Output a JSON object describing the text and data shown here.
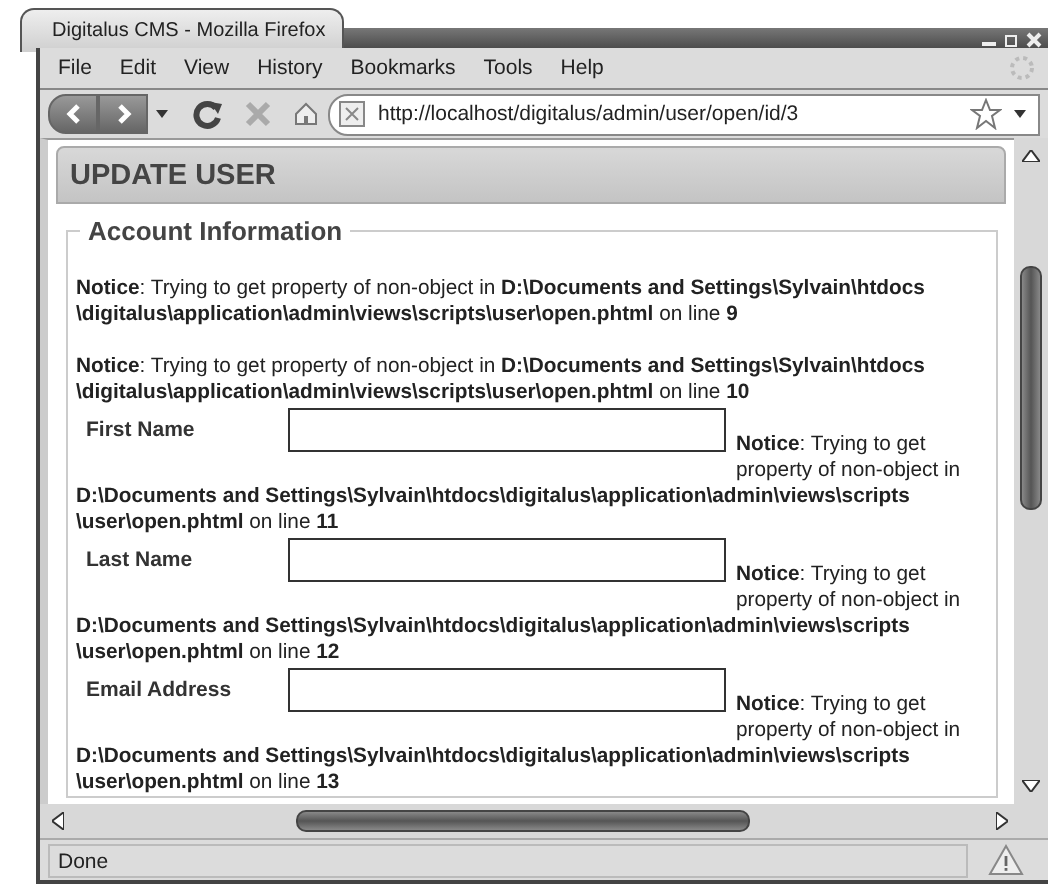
{
  "window": {
    "title": "Digitalus CMS - Mozilla Firefox"
  },
  "menu": [
    "File",
    "Edit",
    "View",
    "History",
    "Bookmarks",
    "Tools",
    "Help"
  ],
  "address_bar": {
    "url": "http://localhost/digitalus/admin/user/open/id/3"
  },
  "page": {
    "heading": "UPDATE USER",
    "fieldset": {
      "legend": "Account Information",
      "notices": [
        {
          "lines": [
            "**Notice**: Trying to get property of non-object in **D:\\Documents and Settings\\Sylvain\\htdocs**",
            "**\\digitalus\\application\\admin\\views\\scripts\\user\\open.phtml** on line **9**"
          ]
        },
        {
          "lines": [
            "**Notice**: Trying to get property of non-object in **D:\\Documents and Settings\\Sylvain\\htdocs**",
            "**\\digitalus\\application\\admin\\views\\scripts\\user\\open.phtml** on line **10**"
          ]
        }
      ],
      "fields": [
        {
          "label": "First Name",
          "notice_lines": [
            "**Notice**: Trying to get",
            "property of non-object in",
            "**D:\\Documents and Settings\\Sylvain\\htdocs\\digitalus\\application\\admin\\views\\scripts**",
            "**\\user\\open.phtml** on line **11**"
          ]
        },
        {
          "label": "Last Name",
          "notice_lines": [
            "**Notice**: Trying to get",
            "property of non-object in",
            "**D:\\Documents and Settings\\Sylvain\\htdocs\\digitalus\\application\\admin\\views\\scripts**",
            "**\\user\\open.phtml** on line **12**"
          ]
        },
        {
          "label": "Email Address",
          "notice_lines": [
            "**Notice**: Trying to get",
            "property of non-object in",
            "**D:\\Documents and Settings\\Sylvain\\htdocs\\digitalus\\application\\admin\\views\\scripts**",
            "**\\user\\open.phtml** on line **13**"
          ]
        }
      ]
    }
  },
  "status_bar": {
    "text": "Done"
  }
}
